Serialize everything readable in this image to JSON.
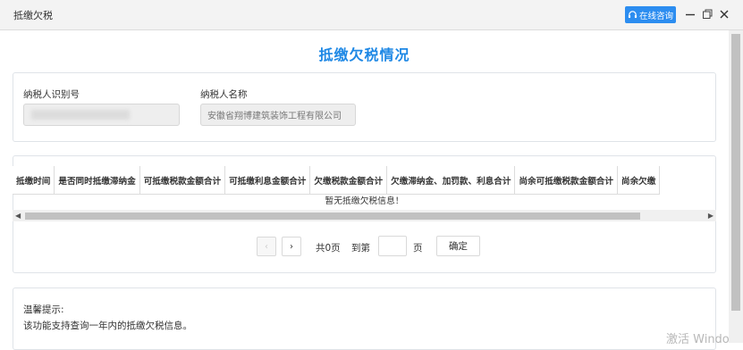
{
  "window": {
    "title": "抵缴欠税",
    "consult_label": "在线咨询"
  },
  "page": {
    "title": "抵缴欠税情况"
  },
  "taxpayer": {
    "id_label": "纳税人识别号",
    "id_value": "",
    "name_label": "纳税人名称",
    "name_value": "安徽省翔博建筑装饰工程有限公司"
  },
  "table": {
    "columns": [
      "抵缴时间",
      "是否同时抵缴滞纳金",
      "可抵缴税款金额合计",
      "可抵缴利息金额合计",
      "欠缴税款金额合计",
      "欠缴滞纳金、加罚款、利息合计",
      "尚余可抵缴税款金额合计",
      "尚余欠缴"
    ],
    "empty_message": "暂无抵缴欠税信息！"
  },
  "pagination": {
    "total_text": "共0页",
    "goto_label": "到第",
    "page_unit": "页",
    "confirm_label": "确定",
    "page_input_value": ""
  },
  "tips": {
    "title": "温馨提示:",
    "text": "该功能支持查询一年内的抵缴欠税信息。"
  },
  "watermark": "激活 Windo",
  "colors": {
    "accent": "#1e88e5",
    "button": "#2c8df0"
  }
}
